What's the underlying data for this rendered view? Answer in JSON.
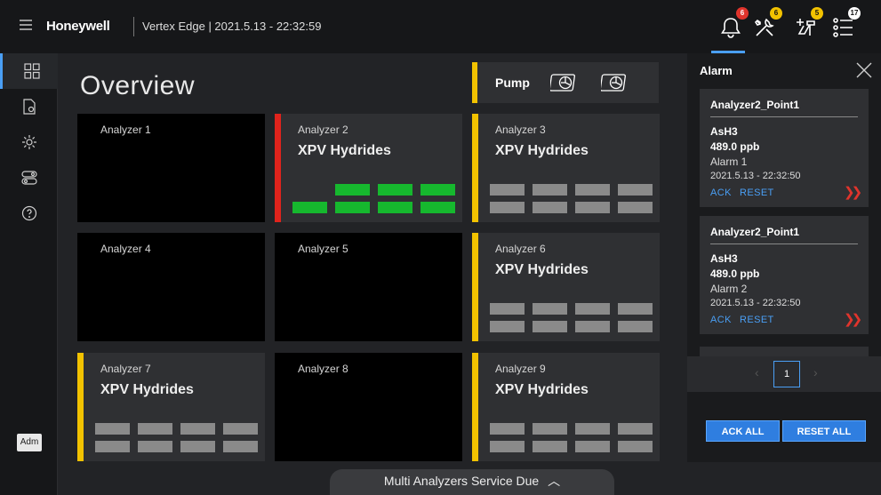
{
  "header": {
    "brand": "Honeywell",
    "device_time": "Vertex Edge | 2021.5.13 - 22:32:59",
    "notifications": [
      {
        "icon": "bell-icon",
        "count": "6",
        "color": "#e0342c"
      },
      {
        "icon": "tools-icon",
        "count": "6",
        "color": "#f2c200"
      },
      {
        "icon": "maintenance-icon",
        "count": "5",
        "color": "#f2c200"
      },
      {
        "icon": "list-icon",
        "count": "17",
        "color": "#ffffff"
      }
    ]
  },
  "sidebar": {
    "items": [
      {
        "name": "overview-nav-icon"
      },
      {
        "name": "report-nav-icon"
      },
      {
        "name": "settings-nav-icon"
      },
      {
        "name": "toggles-nav-icon"
      },
      {
        "name": "help-nav-icon"
      }
    ],
    "user": "Adm"
  },
  "main": {
    "title": "Overview",
    "pump": {
      "label": "Pump"
    },
    "tiles": [
      {
        "name": "Analyzer 1",
        "sub": "",
        "status": "none",
        "cells": []
      },
      {
        "name": "Analyzer 2",
        "sub": "XPV Hydrides",
        "status": "#e0231c",
        "cells": [
          "empty",
          "green",
          "green",
          "green",
          "green",
          "green",
          "green",
          "green"
        ]
      },
      {
        "name": "Analyzer 3",
        "sub": "XPV Hydrides",
        "status": "#f2c200",
        "cells": [
          "gray",
          "gray",
          "gray",
          "gray",
          "gray",
          "gray",
          "gray",
          "gray"
        ]
      },
      {
        "name": "Analyzer 4",
        "sub": "",
        "status": "none",
        "cells": []
      },
      {
        "name": "Analyzer 5",
        "sub": "",
        "status": "none",
        "cells": []
      },
      {
        "name": "Analyzer 6",
        "sub": "XPV Hydrides",
        "status": "#f2c200",
        "cells": [
          "gray",
          "gray",
          "gray",
          "gray",
          "gray",
          "gray",
          "gray",
          "gray"
        ]
      },
      {
        "name": "Analyzer 7",
        "sub": "XPV Hydrides",
        "status": "#f2c200",
        "cells": [
          "gray",
          "gray",
          "gray",
          "gray",
          "gray",
          "gray",
          "gray",
          "gray"
        ]
      },
      {
        "name": "Analyzer 8",
        "sub": "",
        "status": "none",
        "cells": []
      },
      {
        "name": "Analyzer 9",
        "sub": "XPV Hydrides",
        "status": "#f2c200",
        "cells": [
          "gray",
          "gray",
          "gray",
          "gray",
          "gray",
          "gray",
          "gray",
          "gray"
        ]
      }
    ],
    "service_tab": "Multi Analyzers Service Due"
  },
  "alarm": {
    "title": "Alarm",
    "cards": [
      {
        "point": "Analyzer2_Point1",
        "gas": "AsH3",
        "value": "489.0 ppb",
        "level": "Alarm 1",
        "time": "2021.5.13 - 22:32:50",
        "ack": "ACK",
        "reset": "RESET"
      },
      {
        "point": "Analyzer2_Point1",
        "gas": "AsH3",
        "value": "489.0 ppb",
        "level": "Alarm 2",
        "time": "2021.5.13 - 22:32:50",
        "ack": "ACK",
        "reset": "RESET"
      }
    ],
    "page": "1",
    "ack_all": "ACK ALL",
    "reset_all": "RESET ALL"
  },
  "colors": {
    "green": "#16b82e",
    "gray": "#8a8a8a",
    "accent": "#4a9ff5"
  }
}
